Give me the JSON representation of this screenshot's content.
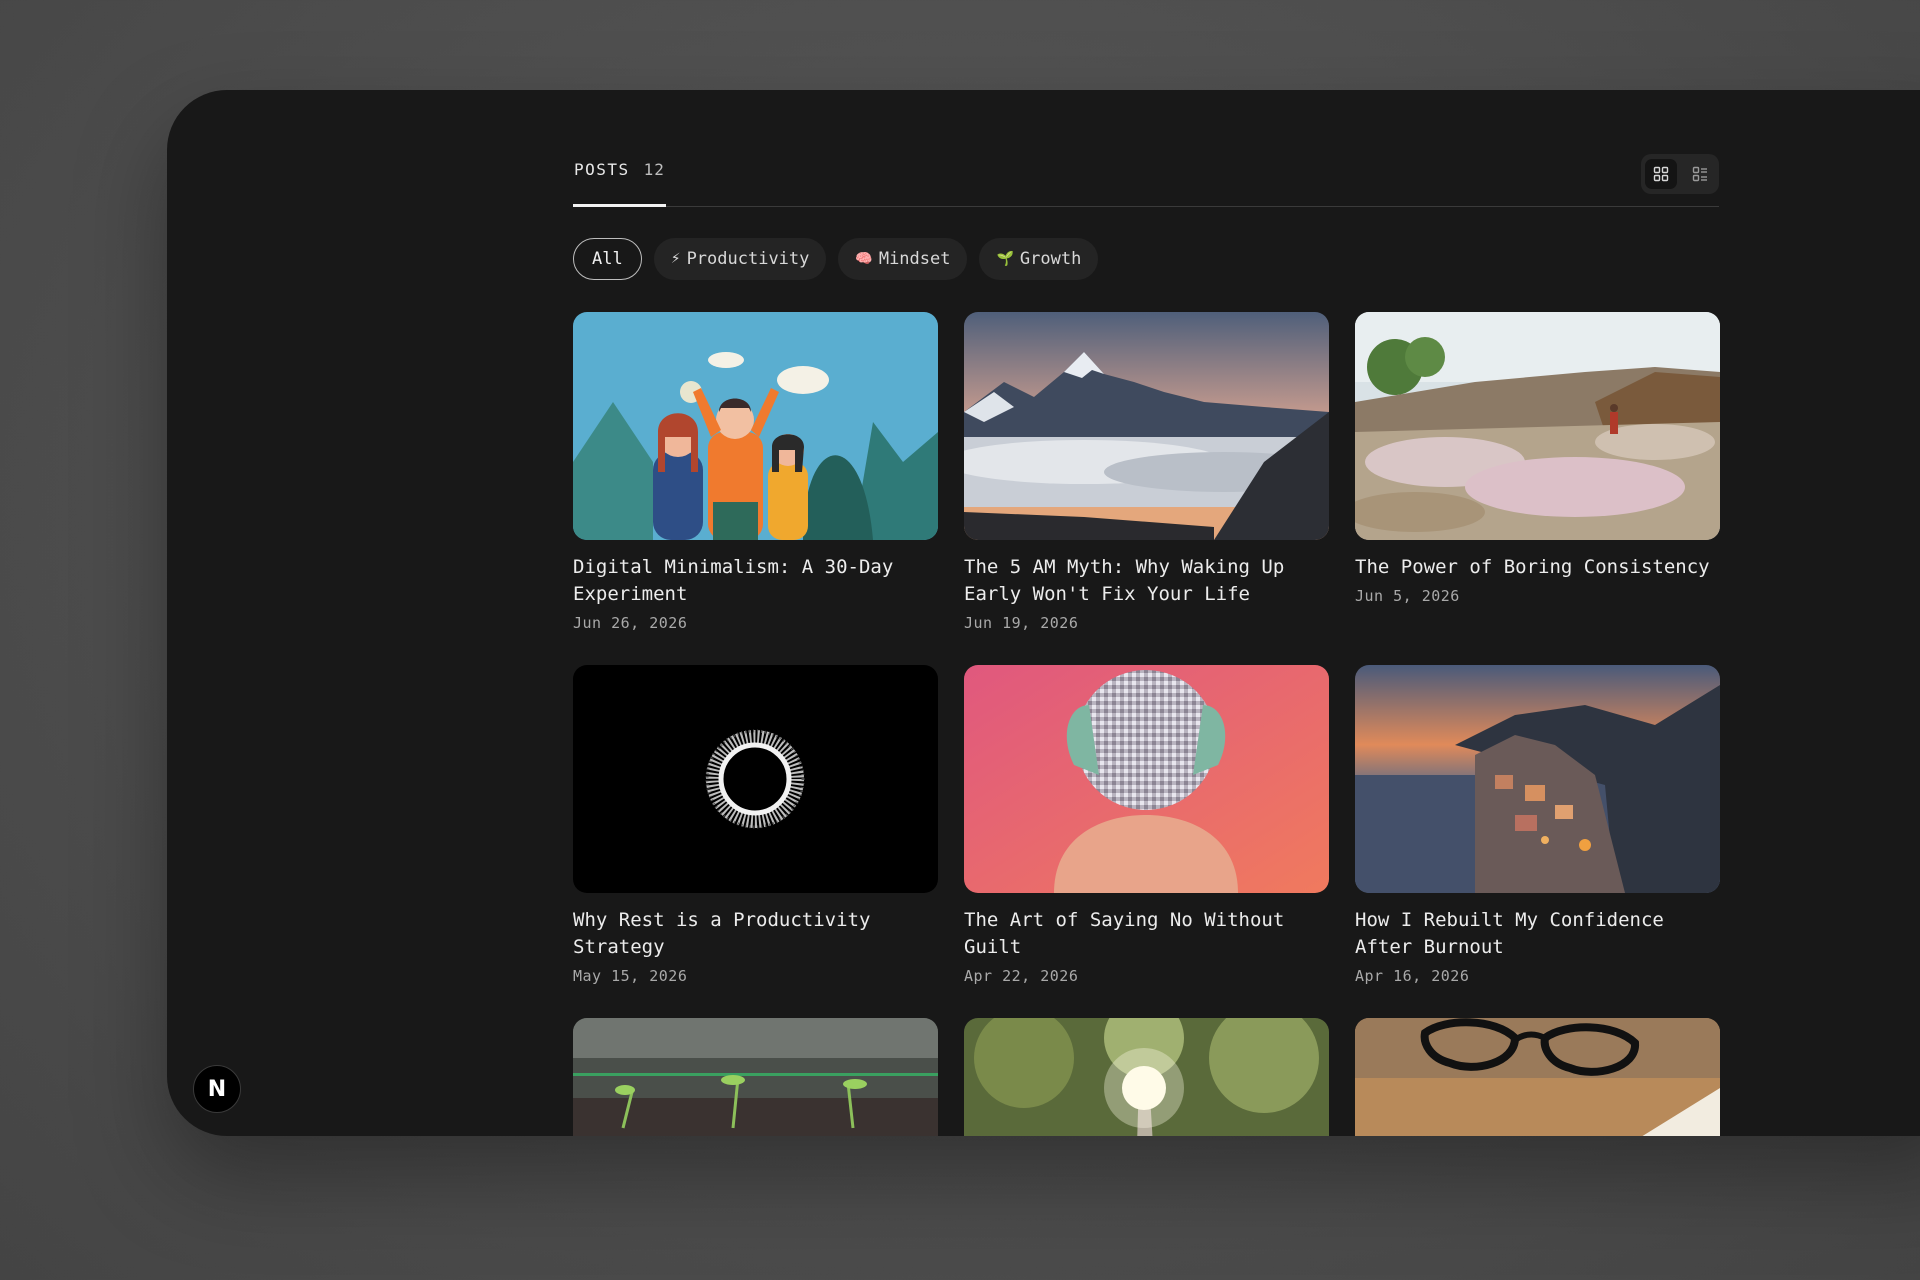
{
  "tabs": {
    "posts_label": "POSTS",
    "posts_count": "12"
  },
  "view_toggle": {
    "grid_icon": "grid-view-icon",
    "list_icon": "list-view-icon",
    "active": "grid"
  },
  "filters": [
    {
      "label": "All",
      "emoji": "",
      "active": true
    },
    {
      "label": "Productivity",
      "emoji": "⚡",
      "active": false
    },
    {
      "label": "Mindset",
      "emoji": "🧠",
      "active": false
    },
    {
      "label": "Growth",
      "emoji": "🌱",
      "active": false
    }
  ],
  "posts": [
    {
      "title": "Digital Minimalism: A 30-Day Experiment",
      "date": "Jun 26, 2026"
    },
    {
      "title": "The 5 AM Myth: Why Waking Up Early Won't Fix Your Life",
      "date": "Jun 19, 2026"
    },
    {
      "title": "The Power of Boring Consistency",
      "date": "Jun 5, 2026"
    },
    {
      "title": "Why Rest is a Productivity Strategy",
      "date": "May 15, 2026"
    },
    {
      "title": "The Art of Saying No Without Guilt",
      "date": "Apr 22, 2026"
    },
    {
      "title": "How I Rebuilt My Confidence After Burnout",
      "date": "Apr 16, 2026"
    },
    {
      "title": "",
      "date": ""
    },
    {
      "title": "",
      "date": ""
    },
    {
      "title": "",
      "date": ""
    }
  ],
  "badge": {
    "letter": "N"
  }
}
